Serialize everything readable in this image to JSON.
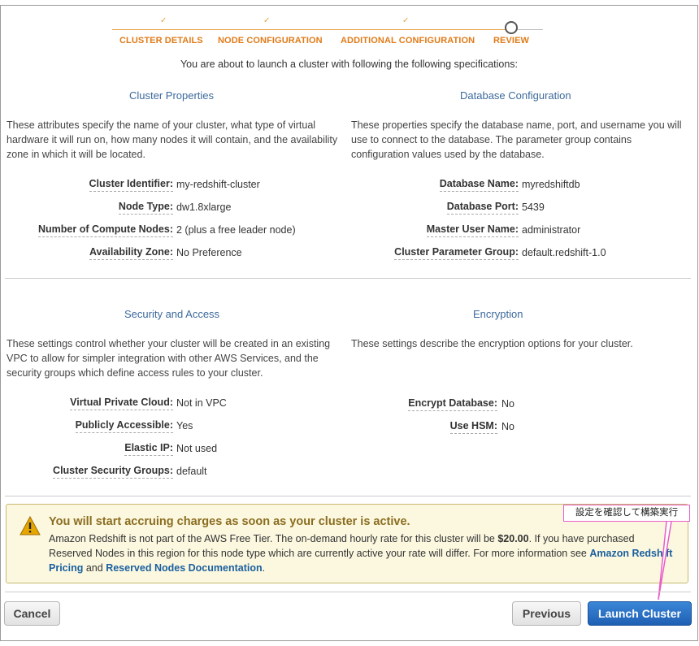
{
  "wizard": {
    "steps": [
      "CLUSTER DETAILS",
      "NODE CONFIGURATION",
      "ADDITIONAL CONFIGURATION",
      "REVIEW"
    ],
    "check_glyph": "✓"
  },
  "intro": "You are about to launch a cluster with following the following specifications:",
  "cluster_properties": {
    "title": "Cluster Properties",
    "description": "These attributes specify the name of your cluster, what type of virtual hardware it will run on, how many nodes it will contain, and the availability zone in which it will be located.",
    "items": [
      {
        "key": "Cluster Identifier:",
        "value": "my-redshift-cluster"
      },
      {
        "key": "Node Type:",
        "value": "dw1.8xlarge"
      },
      {
        "key": "Number of Compute Nodes:",
        "value": "2 (plus a free leader node)"
      },
      {
        "key": "Availability Zone:",
        "value": "No Preference"
      }
    ]
  },
  "database_configuration": {
    "title": "Database Configuration",
    "description": "These properties specify the database name, port, and username you will use to connect to the database. The parameter group contains configuration values used by the database.",
    "items": [
      {
        "key": "Database Name:",
        "value": "myredshiftdb"
      },
      {
        "key": "Database Port:",
        "value": "5439"
      },
      {
        "key": "Master User Name:",
        "value": "administrator"
      },
      {
        "key": "Cluster Parameter Group:",
        "value": "default.redshift-1.0"
      }
    ]
  },
  "security_access": {
    "title": "Security and Access",
    "description": "These settings control whether your cluster will be created in an existing VPC to allow for simpler integration with other AWS Services, and the security groups which define access rules to your cluster.",
    "items": [
      {
        "key": "Virtual Private Cloud:",
        "value": "Not in VPC"
      },
      {
        "key": "Publicly Accessible:",
        "value": "Yes"
      },
      {
        "key": "Elastic IP:",
        "value": "Not used"
      },
      {
        "key": "Cluster Security Groups:",
        "value": "default"
      }
    ]
  },
  "encryption": {
    "title": "Encryption",
    "description": "These settings describe the encryption options for your cluster.",
    "items": [
      {
        "key": "Encrypt Database:",
        "value": "No"
      },
      {
        "key": "Use HSM:",
        "value": "No"
      }
    ]
  },
  "warning": {
    "title": "You will start accruing charges as soon as your cluster is active.",
    "text_1": "Amazon Redshift is not part of the AWS Free Tier. The on-demand hourly rate for this cluster will be ",
    "rate": "$20.00",
    "text_2": ". If you have purchased Reserved Nodes in this region for this node type which are currently active your rate will differ. For more information see ",
    "link_pricing": "Amazon Redshift Pricing",
    "text_and": " and ",
    "link_reserved": "Reserved Nodes Documentation",
    "text_end": "."
  },
  "callout": "設定を確認して構築実行",
  "buttons": {
    "cancel": "Cancel",
    "previous": "Previous",
    "launch": "Launch Cluster"
  },
  "colors": {
    "accent_orange": "#e07b18",
    "section_blue": "#3d6a9c",
    "primary_button": "#1e5fb3",
    "callout_pink": "#e85ec8"
  }
}
